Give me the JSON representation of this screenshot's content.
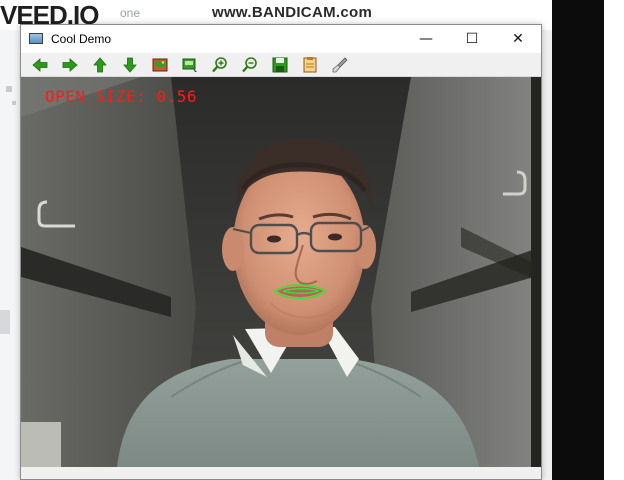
{
  "background": {
    "logo_text": "VEED.IO",
    "logo_sub": "one",
    "watermark": "www.BANDICAM.com"
  },
  "window": {
    "title": "Cool Demo",
    "controls": {
      "minimize": "—",
      "maximize": "☐",
      "close": "✕"
    }
  },
  "toolbar": {
    "buttons": [
      {
        "name": "pan-left",
        "icon": "arrow-left-icon"
      },
      {
        "name": "pan-right",
        "icon": "arrow-right-icon"
      },
      {
        "name": "pan-up",
        "icon": "arrow-up-icon"
      },
      {
        "name": "pan-down",
        "icon": "arrow-down-icon"
      },
      {
        "name": "zoom-to-image",
        "icon": "image-icon"
      },
      {
        "name": "display-properties",
        "icon": "properties-icon"
      },
      {
        "name": "zoom-in",
        "icon": "zoom-in-icon"
      },
      {
        "name": "zoom-out",
        "icon": "zoom-out-icon"
      },
      {
        "name": "save-image",
        "icon": "save-icon"
      },
      {
        "name": "copy-image",
        "icon": "copy-icon"
      },
      {
        "name": "properties",
        "icon": "brush-icon"
      }
    ]
  },
  "overlay": {
    "open_size_label": "OPEN_SIZE: 0.56"
  },
  "colors": {
    "overlay_text": "#ff1a1a",
    "lip_contour": "#39e22e",
    "toolbar_icon_green": "#2e9a1c"
  }
}
